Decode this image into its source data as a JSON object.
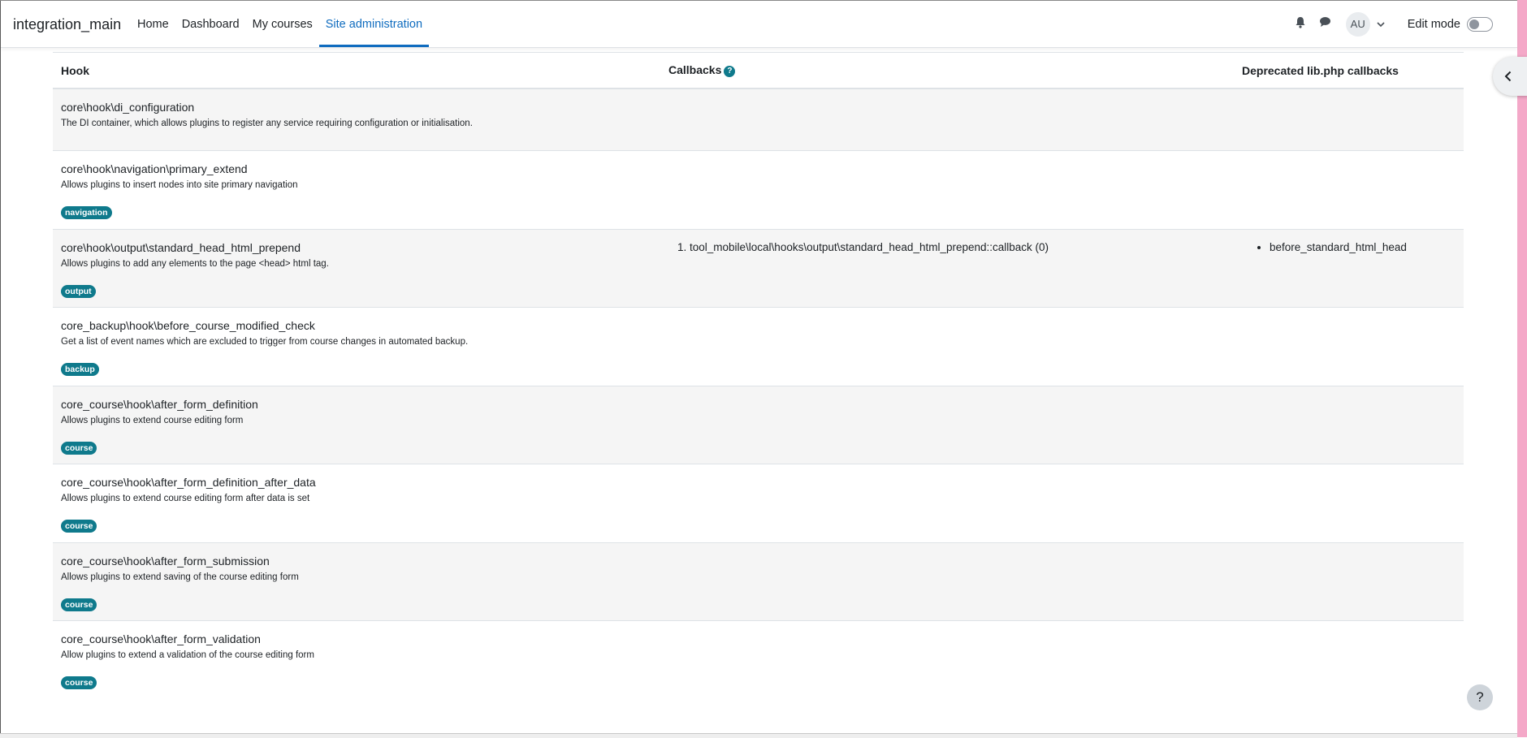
{
  "navbar": {
    "brand": "integration_main",
    "items": [
      {
        "label": "Home",
        "active": false
      },
      {
        "label": "Dashboard",
        "active": false
      },
      {
        "label": "My courses",
        "active": false
      },
      {
        "label": "Site administration",
        "active": true
      }
    ],
    "avatar_initials": "AU",
    "edit_mode_label": "Edit mode",
    "edit_mode_on": false,
    "icons": [
      "bell-icon",
      "chat-icon",
      "chevron-down-icon"
    ]
  },
  "table": {
    "headers": {
      "hook": "Hook",
      "callbacks": "Callbacks",
      "deprecated": "Deprecated lib.php callbacks"
    },
    "rows": [
      {
        "name": "core\\hook\\di_configuration",
        "description": "The DI container, which allows plugins to register any service requiring configuration or initialisation.",
        "tag": "",
        "callbacks": [],
        "deprecated": []
      },
      {
        "name": "core\\hook\\navigation\\primary_extend",
        "description": "Allows plugins to insert nodes into site primary navigation",
        "tag": "navigation",
        "callbacks": [],
        "deprecated": []
      },
      {
        "name": "core\\hook\\output\\standard_head_html_prepend",
        "description": "Allows plugins to add any elements to the page <head> html tag.",
        "tag": "output",
        "callbacks": [
          "tool_mobile\\local\\hooks\\output\\standard_head_html_prepend::callback (0)"
        ],
        "deprecated": [
          "before_standard_html_head"
        ]
      },
      {
        "name": "core_backup\\hook\\before_course_modified_check",
        "description": "Get a list of event names which are excluded to trigger from course changes in automated backup.",
        "tag": "backup",
        "callbacks": [],
        "deprecated": []
      },
      {
        "name": "core_course\\hook\\after_form_definition",
        "description": "Allows plugins to extend course editing form",
        "tag": "course",
        "callbacks": [],
        "deprecated": []
      },
      {
        "name": "core_course\\hook\\after_form_definition_after_data",
        "description": "Allows plugins to extend course editing form after data is set",
        "tag": "course",
        "callbacks": [],
        "deprecated": []
      },
      {
        "name": "core_course\\hook\\after_form_submission",
        "description": "Allows plugins to extend saving of the course editing form",
        "tag": "course",
        "callbacks": [],
        "deprecated": []
      },
      {
        "name": "core_course\\hook\\after_form_validation",
        "description": "Allow plugins to extend a validation of the course editing form",
        "tag": "course",
        "callbacks": [],
        "deprecated": []
      }
    ]
  },
  "help_button_label": "?",
  "callbacks_help_label": "?"
}
